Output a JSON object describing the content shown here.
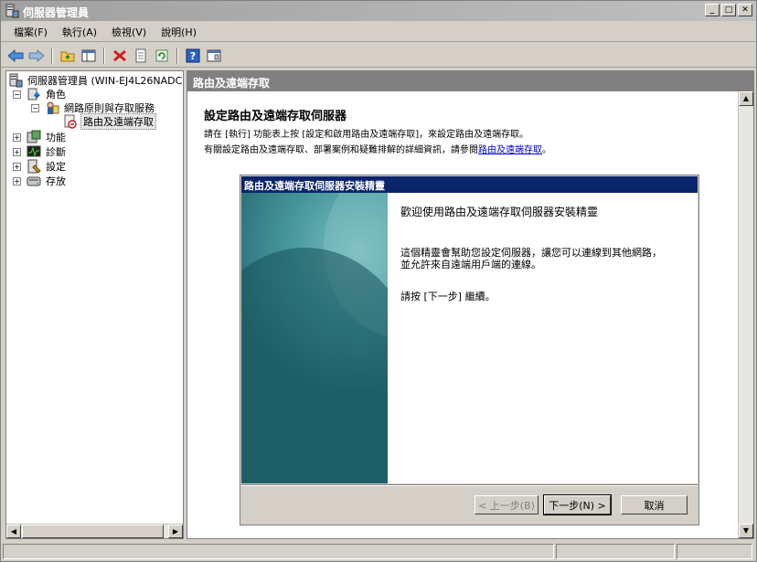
{
  "window": {
    "title": "伺服器管理員"
  },
  "menu": [
    "檔案(F)",
    "執行(A)",
    "檢視(V)",
    "說明(H)"
  ],
  "toolbar": {
    "icons": [
      "back-arrow-icon",
      "forward-arrow-icon",
      "up-folder-icon",
      "show-hide-tree-icon",
      "delete-icon",
      "properties-icon",
      "refresh-icon",
      "help-icon",
      "console-icon"
    ]
  },
  "tree": {
    "root": "伺服器管理員 (WIN-EJ4L26NADC",
    "roles": "角色",
    "npas": "網路原則與存取服務",
    "rras": "路由及遠端存取",
    "features": "功能",
    "diagnostics": "診斷",
    "config": "設定",
    "storage": "存放"
  },
  "content": {
    "header": "路由及遠端存取",
    "title": "設定路由及遠端存取伺服器",
    "line1": "請在 [執行] 功能表上按 [設定和啟用路由及遠端存取]，來設定路由及遠端存取。",
    "line2_prefix": "有關設定路由及遠端存取、部署案例和疑難排解的詳細資訊，請參閱",
    "line2_link": "路由及遠端存取",
    "line2_suffix": "。"
  },
  "wizard": {
    "title": "路由及遠端存取伺服器安裝精靈",
    "heading": "歡迎使用路由及遠端存取伺服器安裝精靈",
    "text1": "這個精靈會幫助您設定伺服器，讓您可以連線到其他網路，並允許來自遠端用戶端的連線。",
    "text2": "請按 [下一步] 繼續。",
    "back_button": "< 上一步(B)",
    "next_button": "下一步(N) >",
    "cancel_button": "取消"
  }
}
